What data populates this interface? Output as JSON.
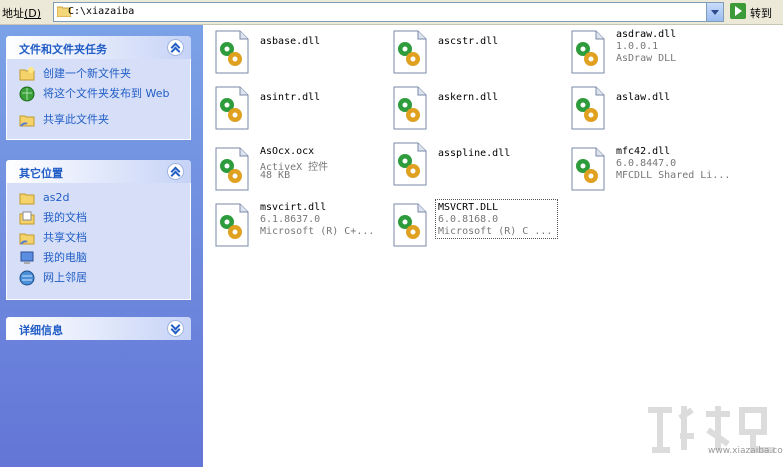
{
  "address_bar": {
    "label": "地址",
    "accel": "(D)",
    "path": "C:\\xiazaiba",
    "go_label": "转到"
  },
  "panels": [
    {
      "title": "文件和文件夹任务",
      "state": "expanded",
      "items": [
        {
          "label": "创建一个新文件夹",
          "icon": "new-folder-icon"
        },
        {
          "label": "将这个文件夹发布到 Web",
          "icon": "publish-web-icon"
        },
        {
          "label": "共享此文件夹",
          "icon": "share-folder-icon"
        }
      ]
    },
    {
      "title": "其它位置",
      "state": "expanded",
      "items": [
        {
          "label": "as2d",
          "icon": "folder-icon"
        },
        {
          "label": "我的文档",
          "icon": "my-documents-icon"
        },
        {
          "label": "共享文档",
          "icon": "shared-documents-icon"
        },
        {
          "label": "我的电脑",
          "icon": "my-computer-icon"
        },
        {
          "label": "网上邻居",
          "icon": "network-places-icon"
        }
      ]
    },
    {
      "title": "详细信息",
      "state": "collapsed",
      "items": []
    }
  ],
  "files": [
    {
      "name": "asbase.dll"
    },
    {
      "name": "ascstr.dll"
    },
    {
      "name": "asdraw.dll",
      "meta1": "1.0.0.1",
      "meta2": "AsDraw DLL"
    },
    {
      "name": "asintr.dll"
    },
    {
      "name": "askern.dll"
    },
    {
      "name": "aslaw.dll"
    },
    {
      "name": "AsOcx.ocx",
      "meta1": "ActiveX 控件",
      "meta2": "48 KB"
    },
    {
      "name": "asspline.dll"
    },
    {
      "name": "mfc42.dll",
      "meta1": "6.0.8447.0",
      "meta2": "MFCDLL Shared Li..."
    },
    {
      "name": "msvcirt.dll",
      "meta1": "6.1.8637.0",
      "meta2": "Microsoft (R) C+..."
    },
    {
      "name": "MSVCRT.DLL",
      "meta1": "6.0.8168.0",
      "meta2": "Microsoft (R) C ...",
      "selected": true
    }
  ],
  "watermark": {
    "text": "www.xiazaiba.com"
  },
  "colors": {
    "task_text": "#215dc6",
    "pane_top": "#7ba2e7",
    "pane_bottom": "#6375d6"
  }
}
